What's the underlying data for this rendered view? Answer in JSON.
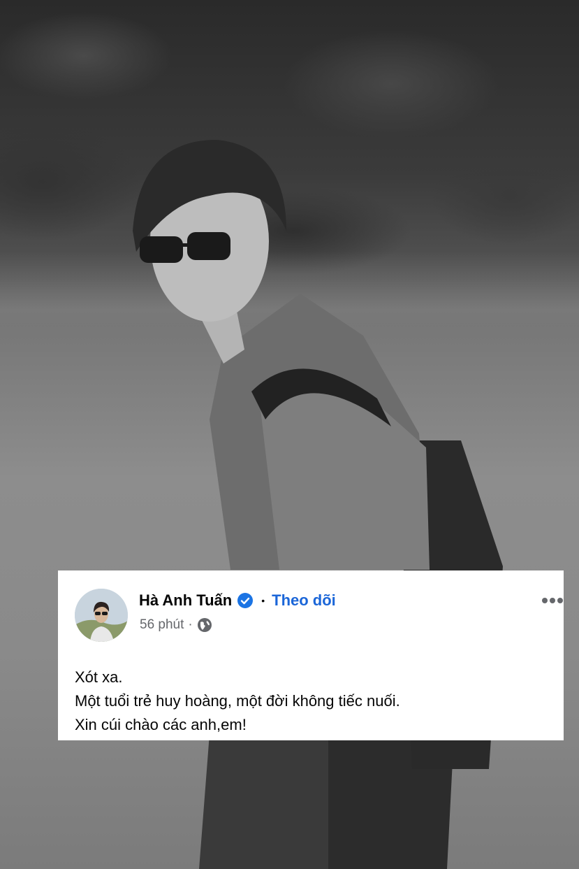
{
  "post": {
    "author_name": "Hà Anh Tuấn",
    "verified_icon": "verified-badge-icon",
    "separator": "•",
    "follow_label": "Theo dõi",
    "time": "56 phút",
    "meta_separator": "·",
    "privacy_icon": "globe-icon",
    "more_icon": "more-options-icon",
    "lines": [
      "Xót xa.",
      "Một tuổi trẻ huy hoàng, một đời không tiếc nuối.",
      "Xin cúi chào các anh,em!"
    ]
  },
  "colors": {
    "follow": "#1b66d8",
    "verified": "#1b74e4",
    "meta_text": "#65676b",
    "card_bg": "#ffffff"
  }
}
